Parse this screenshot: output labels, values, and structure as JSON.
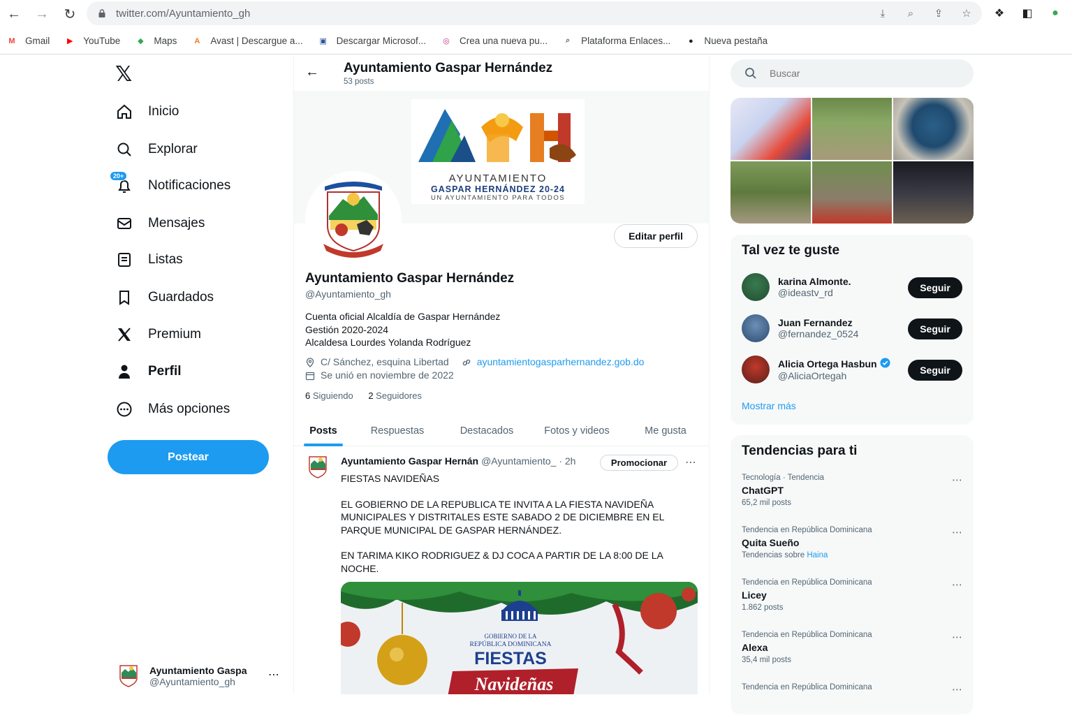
{
  "browser": {
    "url_host": "twitter.com/",
    "url_path": "Ayuntamiento_gh",
    "bookmarks": [
      {
        "label": "Gmail",
        "icon": "gmail-icon",
        "color": "#ea4335"
      },
      {
        "label": "YouTube",
        "icon": "youtube-icon",
        "color": "#ff0000"
      },
      {
        "label": "Maps",
        "icon": "maps-icon",
        "color": "#34a853"
      },
      {
        "label": "Avast | Descargue a...",
        "icon": "avast-icon",
        "color": "#f47920"
      },
      {
        "label": "Descargar Microsof...",
        "icon": "microsoft-icon",
        "color": "#2b579a"
      },
      {
        "label": "Crea una nueva pu...",
        "icon": "instagram-icon",
        "color": "#c13584"
      },
      {
        "label": "Plataforma Enlaces...",
        "icon": "search-icon",
        "color": "#5f6368"
      },
      {
        "label": "Nueva pestaña",
        "icon": "globe-icon",
        "color": "#202124"
      }
    ]
  },
  "nav": {
    "items": [
      {
        "label": "Inicio",
        "icon": "home-icon"
      },
      {
        "label": "Explorar",
        "icon": "search-icon"
      },
      {
        "label": "Notificaciones",
        "icon": "bell-icon",
        "badge": "20+"
      },
      {
        "label": "Mensajes",
        "icon": "mail-icon"
      },
      {
        "label": "Listas",
        "icon": "list-icon"
      },
      {
        "label": "Guardados",
        "icon": "bookmark-icon"
      },
      {
        "label": "Premium",
        "icon": "x-icon"
      },
      {
        "label": "Perfil",
        "icon": "person-icon"
      },
      {
        "label": "Más opciones",
        "icon": "more-circle-icon"
      }
    ],
    "post_label": "Postear",
    "account": {
      "name": "Ayuntamiento Gaspa",
      "handle": "@Ayuntamiento_gh"
    }
  },
  "profile": {
    "header_title": "Ayuntamiento Gaspar Hernández",
    "header_posts": "53 posts",
    "banner": {
      "line1": "AYUNTAMIENTO",
      "line2": "GASPAR HERNÁNDEZ 20-24",
      "line3": "UN AYUNTAMIENTO PARA TODOS"
    },
    "edit_label": "Editar perfil",
    "name": "Ayuntamiento Gaspar Hernández",
    "handle": "@Ayuntamiento_gh",
    "bio": [
      "Cuenta oficial Alcaldía de Gaspar Hernández",
      "Gestión 2020-2024",
      "Alcaldesa Lourdes Yolanda Rodríguez"
    ],
    "location": "C/ Sánchez, esquina Libertad",
    "website": "ayuntamientogasparhernandez.gob.do",
    "joined": "Se unió en noviembre de 2022",
    "following_count": "6",
    "following_label": "Siguiendo",
    "followers_count": "2",
    "followers_label": "Seguidores",
    "tabs": [
      "Posts",
      "Respuestas",
      "Destacados",
      "Fotos y videos",
      "Me gusta"
    ]
  },
  "tweet": {
    "name": "Ayuntamiento Gaspar Hernán",
    "handle": "@Ayuntamiento_ · 2h",
    "promote_label": "Promocionar",
    "text": "FIESTAS NAVIDEÑAS\n\nEL GOBIERNO DE LA REPUBLICA TE INVITA A LA FIESTA NAVIDEÑA MUNICIPALES Y DISTRITALES ESTE SABADO 2 DE DICIEMBRE EN EL PARQUE MUNICIPAL DE GASPAR HERNÁNDEZ.\n\nEN TARIMA KIKO RODRIGUEZ & DJ COCA A PARTIR DE LA 8:00 DE LA NOCHE.",
    "image_text1": "GOBIERNO DE LA",
    "image_text2": "REPÚBLICA DOMINICANA",
    "image_text3": "FIESTAS",
    "image_text4": "Navideñas"
  },
  "right": {
    "search_placeholder": "Buscar",
    "who_title": "Tal vez te guste",
    "who": [
      {
        "name": "karina Almonte.",
        "handle": "@ideastv_rd",
        "verified": false
      },
      {
        "name": "Juan Fernandez",
        "handle": "@fernandez_0524",
        "verified": false
      },
      {
        "name": "Alicia Ortega Hasbun",
        "handle": "@AliciaOrtegah",
        "verified": true
      }
    ],
    "follow_label": "Seguir",
    "show_more": "Mostrar más",
    "trends_title": "Tendencias para ti",
    "trends": [
      {
        "context": "Tecnología · Tendencia",
        "name": "ChatGPT",
        "posts": "65,2 mil posts"
      },
      {
        "context": "Tendencia en República Dominicana",
        "name": "Quita Sueño",
        "posts": "Tendencias sobre ",
        "link": "Haina"
      },
      {
        "context": "Tendencia en República Dominicana",
        "name": "Licey",
        "posts": "1.862 posts"
      },
      {
        "context": "Tendencia en República Dominicana",
        "name": "Alexa",
        "posts": "35,4 mil posts"
      },
      {
        "context": "Tendencia en República Dominicana",
        "name": "",
        "posts": ""
      }
    ]
  },
  "colors": {
    "accent": "#1d9bf0",
    "text": "#0f1419",
    "muted": "#536471"
  }
}
